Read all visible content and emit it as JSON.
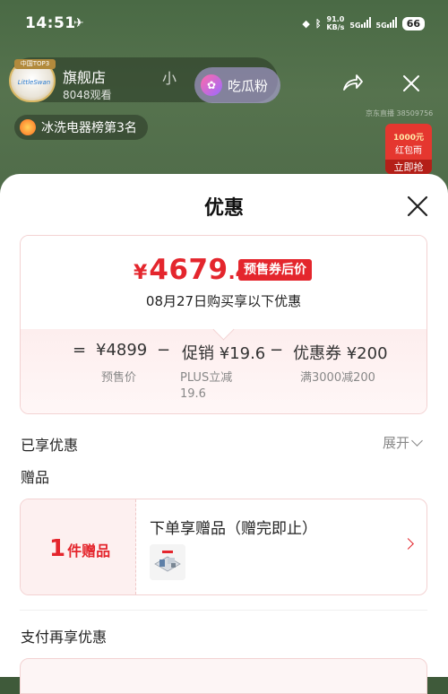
{
  "status_bar": {
    "time": "14:51",
    "net_speed_value": "91.0",
    "net_speed_unit": "KB/s",
    "net1": "5G",
    "net2": "5G",
    "battery": "66"
  },
  "live": {
    "avatar_tag": "中国TOP3",
    "avatar_brand": "LittleSwan",
    "shop_name": "旗舰店",
    "viewers": "8048观看",
    "shop_sub": "小",
    "chigua_label": "吃瓜粉",
    "rank_text": "冰洗电器榜第3名",
    "watermark": "京东直播 38509756",
    "redpacket": {
      "amount": "1000元",
      "name": "红包雨",
      "action": "立即抢"
    }
  },
  "sheet": {
    "title": "优惠",
    "price": {
      "symbol": "¥",
      "integer": "4679",
      "decimal": ".4",
      "badge": "预售券后价",
      "date_text": "08月27日购买享以下优惠"
    },
    "calc": {
      "eq": "=",
      "base": "¥4899",
      "base_label": "预售价",
      "minus1": "−",
      "promo": "促销 ¥19.6",
      "promo_label": "PLUS立减",
      "promo_label2": "19.6",
      "minus2": "−",
      "coupon": "优惠券 ¥200",
      "coupon_label": "满3000减200"
    },
    "enjoyed_label": "已享优惠",
    "expand_label": "展开",
    "gift_section": "赠品",
    "gift": {
      "count": "1",
      "unit": "件赠品",
      "title": "下单享赠品（赠完即止）"
    },
    "pay_section": "支付再享优惠"
  },
  "colors": {
    "accent": "#e4262d",
    "badge_bg": "#e4262d",
    "card_border": "#f3d2d2"
  }
}
